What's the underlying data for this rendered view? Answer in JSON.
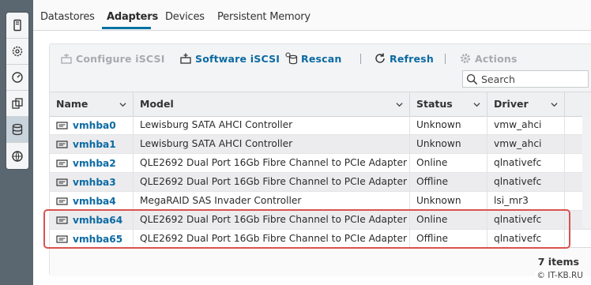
{
  "tabs": [
    "Datastores",
    "Adapters",
    "Devices",
    "Persistent Memory"
  ],
  "active_tab": "Adapters",
  "toolbar": {
    "configure": "Configure iSCSI",
    "software": "Software iSCSI",
    "rescan": "Rescan",
    "refresh": "Refresh",
    "actions": "Actions"
  },
  "search": {
    "placeholder": "Search"
  },
  "columns": {
    "name": "Name",
    "model": "Model",
    "status": "Status",
    "driver": "Driver"
  },
  "rows": [
    {
      "name": "vmhba0",
      "model": "Lewisburg SATA AHCI Controller",
      "status": "Unknown",
      "driver": "vmw_ahci"
    },
    {
      "name": "vmhba1",
      "model": "Lewisburg SATA AHCI Controller",
      "status": "Unknown",
      "driver": "vmw_ahci"
    },
    {
      "name": "vmhba2",
      "model": "QLE2692 Dual Port 16Gb Fibre Channel to PCIe Adapter",
      "status": "Online",
      "driver": "qlnativefc"
    },
    {
      "name": "vmhba3",
      "model": "QLE2692 Dual Port 16Gb Fibre Channel to PCIe Adapter",
      "status": "Offline",
      "driver": "qlnativefc"
    },
    {
      "name": "vmhba4",
      "model": "MegaRAID SAS Invader Controller",
      "status": "Unknown",
      "driver": "lsi_mr3"
    },
    {
      "name": "vmhba64",
      "model": "QLE2692 Dual Port 16Gb Fibre Channel to PCIe Adapter",
      "status": "Online",
      "driver": "qlnativefc"
    },
    {
      "name": "vmhba65",
      "model": "QLE2692 Dual Port 16Gb Fibre Channel to PCIe Adapter",
      "status": "Offline",
      "driver": "qlnativefc"
    }
  ],
  "footer": {
    "count": "7 items"
  },
  "watermark": "© IT-KB.RU",
  "sidebar_icons": [
    "host-icon",
    "settings-icon",
    "monitor-icon",
    "vms-icon",
    "storage-icon",
    "networking-icon"
  ],
  "colors": {
    "link": "#0b6aa3",
    "highlight": "#d9534f",
    "sidebar": "#5a6670"
  }
}
